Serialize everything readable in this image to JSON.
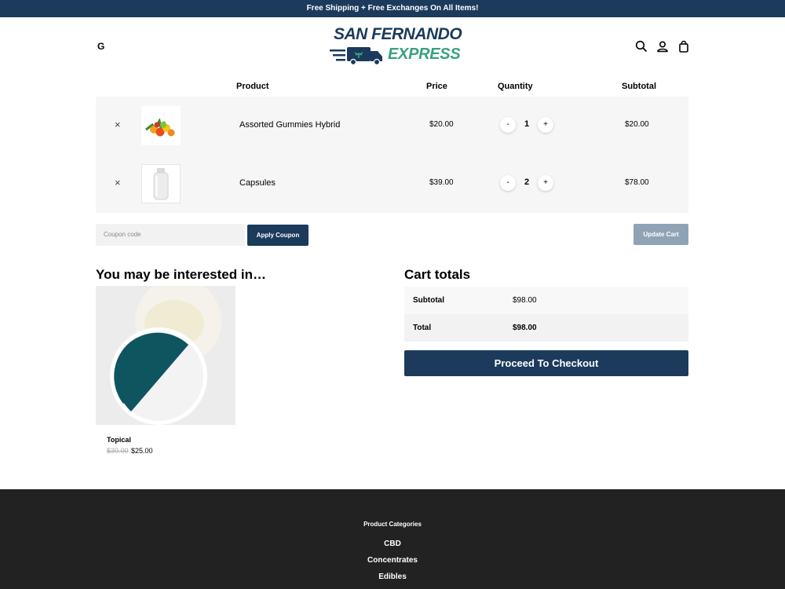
{
  "announcement": "Free Shipping + Free Exchanges On All Items!",
  "header": {
    "left_logo": "G",
    "brand_line1": "SAN FERNANDO",
    "brand_line2": "EXPRESS",
    "icons": [
      "search-icon",
      "account-icon",
      "cart-bag-icon"
    ]
  },
  "cart": {
    "columns": [
      "Product",
      "Price",
      "Quantity",
      "Subtotal"
    ],
    "items": [
      {
        "name": "Assorted Gummies Hybrid",
        "price": "$20.00",
        "quantity": "1",
        "subtotal": "$20.00",
        "remove": "×",
        "minus": "-",
        "plus": "+"
      },
      {
        "name": "Capsules",
        "price": "$39.00",
        "quantity": "2",
        "subtotal": "$78.00",
        "remove": "×",
        "minus": "-",
        "plus": "+"
      }
    ],
    "coupon_placeholder": "Coupon code",
    "apply_label": "Apply Coupon",
    "update_label": "Update Cart"
  },
  "interested": {
    "heading": "You may be interested in…",
    "product": {
      "name": "Topical",
      "old_price": "$30.00",
      "price": "$25.00"
    }
  },
  "totals": {
    "heading": "Cart totals",
    "subtotal_label": "Subtotal",
    "subtotal_value": "$98.00",
    "total_label": "Total",
    "total_value": "$98.00",
    "checkout_label": "Proceed To Checkout"
  },
  "footer": {
    "heading": "Product Categories",
    "links": [
      "CBD",
      "Concentrates",
      "Edibles"
    ]
  },
  "colors": {
    "brand_navy": "#1b3a5c",
    "brand_green": "#3aa17e",
    "footer_bg": "#222222"
  }
}
